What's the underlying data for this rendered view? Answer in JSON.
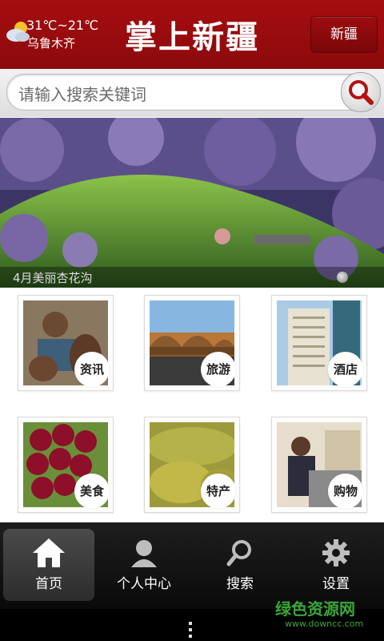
{
  "header": {
    "temperature": "31℃~21℃",
    "city": "乌鲁木齐",
    "title": "掌上新疆",
    "region_button": "新疆",
    "weather_icon": "partly-cloudy-icon"
  },
  "search": {
    "placeholder": "请输入搜索关键词",
    "button_icon": "search-icon"
  },
  "banner": {
    "caption": "4月美丽杏花沟",
    "slide_indicator_count": 1
  },
  "categories": [
    {
      "label": "资讯",
      "icon": "news-photo"
    },
    {
      "label": "旅游",
      "icon": "travel-photo"
    },
    {
      "label": "酒店",
      "icon": "hotel-photo"
    },
    {
      "label": "美食",
      "icon": "food-photo"
    },
    {
      "label": "特产",
      "icon": "specialty-photo"
    },
    {
      "label": "购物",
      "icon": "shopping-photo"
    }
  ],
  "nav": [
    {
      "label": "首页",
      "icon": "home-icon",
      "active": true
    },
    {
      "label": "个人中心",
      "icon": "user-icon",
      "active": false
    },
    {
      "label": "搜索",
      "icon": "search-icon",
      "active": false
    },
    {
      "label": "设置",
      "icon": "gear-icon",
      "active": false
    }
  ],
  "watermark": {
    "text": "绿色资源网",
    "url": "www.downcc.com"
  },
  "colors": {
    "header_red": "#a60d10",
    "nav_bg": "#111111",
    "watermark_green": "#3aa83a"
  }
}
